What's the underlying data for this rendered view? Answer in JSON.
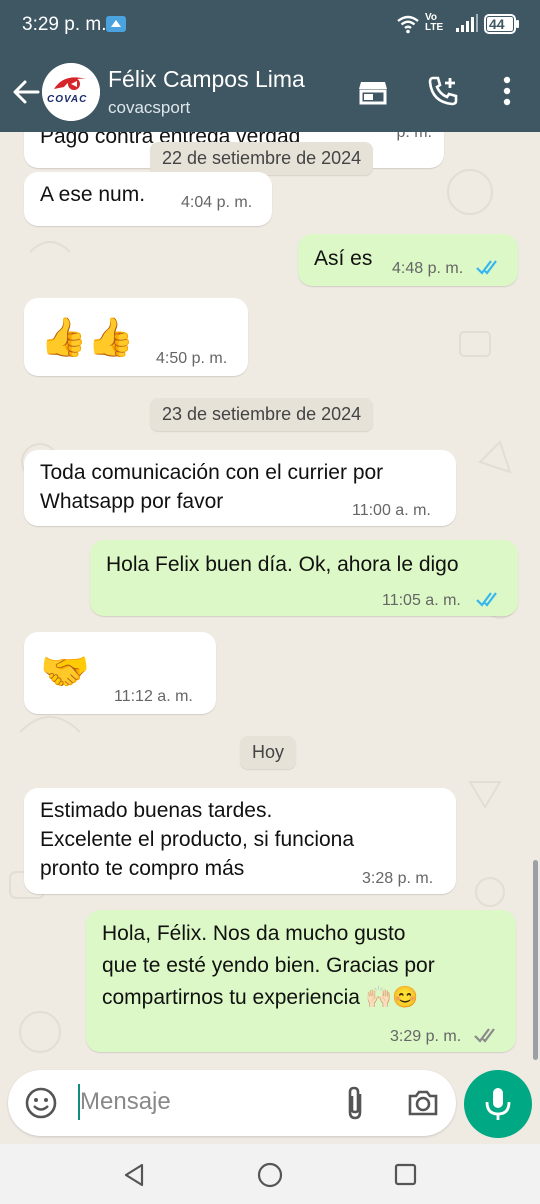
{
  "status_bar": {
    "time": "3:29 p. m.",
    "volte": "Vo\nLTE",
    "battery": "44"
  },
  "header": {
    "contact_name": "Félix Campos Lima",
    "subtitle": "covacsport",
    "avatar_text": "COVAC"
  },
  "chat": {
    "top_clipped_text": "Pago contra entrega verdad",
    "top_clipped_time": "p. m.",
    "dates": [
      "22 de setiembre de 2024",
      "23 de setiembre de 2024",
      "Hoy"
    ],
    "messages": [
      {
        "dir": "in",
        "text": "A ese num.",
        "time": "4:04 p. m."
      },
      {
        "dir": "out",
        "text": "Así es",
        "time": "4:48 p. m.",
        "status": "read"
      },
      {
        "dir": "in",
        "text": "👍👍",
        "time": "4:50 p. m."
      },
      {
        "dir": "in",
        "text": "Toda comunicación con el currier por\nWhatsapp por favor",
        "time": "11:00 a. m."
      },
      {
        "dir": "out",
        "text": "Hola Felix buen día. Ok, ahora le digo",
        "time": "11:05 a. m.",
        "status": "read"
      },
      {
        "dir": "in",
        "text": "🤝",
        "time": "11:12 a. m."
      },
      {
        "dir": "in",
        "text": "Estimado buenas tardes.\nExcelente el producto, si funciona\npronto te compro más",
        "time": "3:28 p. m."
      },
      {
        "dir": "out",
        "text": "Hola, Félix. Nos da mucho gusto\nque te esté yendo bien. Gracias por\ncompartirnos tu experiencia 🙌🏻😊",
        "time": "3:29 p. m.",
        "status": "delivered"
      }
    ]
  },
  "input": {
    "placeholder": "Mensaje"
  },
  "colors": {
    "header": "#3f5763",
    "chat_bg": "#efeae2",
    "outgoing": "#dcf8c6",
    "incoming": "#ffffff",
    "accent": "#00a884",
    "read_tick": "#34b7f1",
    "delivered_tick": "#8a8a8a"
  },
  "icons": {
    "back": "arrow-left-icon",
    "store": "store-icon",
    "add_call": "add-call-icon",
    "more": "more-vert-icon",
    "emoji": "emoji-icon",
    "attach": "paperclip-icon",
    "camera": "camera-icon",
    "mic": "mic-icon"
  }
}
